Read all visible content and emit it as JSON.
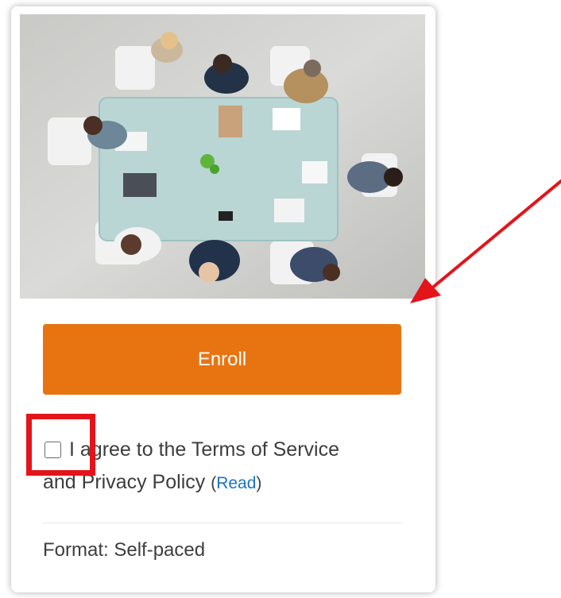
{
  "card": {
    "image_alt": "Business people meeting around a table, top-down view",
    "enroll_label": "Enroll",
    "terms_line1": "I agree to the Terms of Service",
    "terms_line2": "and Privacy Policy",
    "read_paren_open": "(",
    "read_link": "Read",
    "read_paren_close": ")",
    "format_label": "Format:",
    "format_value": "Self-paced",
    "terms_checked": false
  },
  "colors": {
    "enroll_button": "#e87411",
    "read_link": "#1a73c7",
    "annotation_red": "#e4141b"
  }
}
